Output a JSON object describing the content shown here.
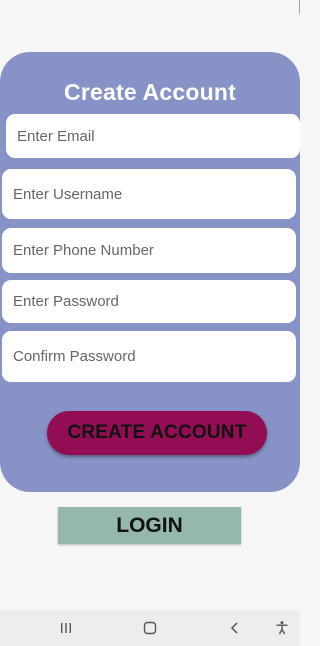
{
  "form": {
    "title": "Create Account",
    "fields": {
      "email": {
        "placeholder": "Enter Email",
        "value": ""
      },
      "username": {
        "placeholder": "Enter Username",
        "value": ""
      },
      "phone": {
        "placeholder": "Enter Phone Number",
        "value": ""
      },
      "password": {
        "placeholder": "Enter Password",
        "value": ""
      },
      "confirm": {
        "placeholder": "Confirm Password",
        "value": ""
      }
    },
    "create_label": "CREATE ACCOUNT"
  },
  "login": {
    "label": "LOGIN"
  },
  "nav": {
    "icons": [
      "recent-apps-icon",
      "home-icon",
      "back-icon",
      "accessibility-icon"
    ]
  },
  "colors": {
    "card": "#8792c6",
    "create_button": "#930d55",
    "login_button": "#95b7ae",
    "background": "#f6f6f6",
    "nav_bar": "#ededed"
  }
}
